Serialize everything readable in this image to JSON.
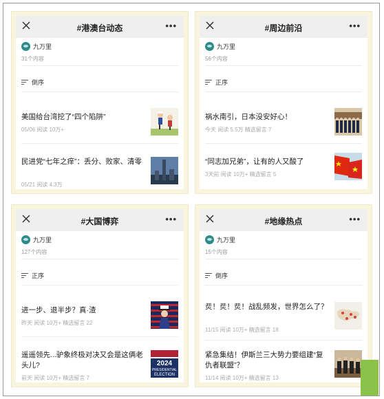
{
  "panels": [
    {
      "title": "#港澳台动态",
      "author": "九万里",
      "count": "31个内容",
      "sort": "倒序",
      "articles": [
        {
          "title": "美国给台湾挖了“四个陷阱”",
          "meta": "05/06  阅读 10万+",
          "thumb": "cartoon-figures"
        },
        {
          "title": "民进党“七年之痒”：丢分、败家、清零",
          "meta": "05/21  阅读 4.3万",
          "thumb": "taipei-101-skyline"
        }
      ]
    },
    {
      "title": "#周边前沿",
      "author": "九万里",
      "count": "56个内容",
      "sort": "正序",
      "articles": [
        {
          "title": "祸水南引，日本没安好心！",
          "meta": "今天  阅读 5.5万  精选留言 7",
          "thumb": "leaders-group-photo"
        },
        {
          "title": "“同志加兄弟”，让有的人又酸了",
          "meta": "3天前  阅读 10万+  精选留言 5",
          "thumb": "china-vietnam-flags"
        }
      ]
    },
    {
      "title": "#大国博弈",
      "author": "九万里",
      "count": "127个内容",
      "sort": "正序",
      "articles": [
        {
          "title": "进一步、退半步？真·渣",
          "meta": "昨天  阅读 10万+  精选留言 22",
          "thumb": "uncle-sam-flag"
        },
        {
          "title": "遥遥领先...驴象终极对决又会是这俩老头儿?",
          "meta": "前天  阅读 10万+  精选留言 7",
          "thumb": "2024 PRESIDENTIAL ELECTION"
        }
      ]
    },
    {
      "title": "#地缘热点",
      "author": "九万里",
      "count": "15个内容",
      "sort": "倒序",
      "articles": [
        {
          "title": "烎！烎！烎！战乱频发，世界怎么了？",
          "meta": "11/15  阅读 10万+  精选留言 18",
          "thumb": "world-map"
        },
        {
          "title": "紧急集结！伊斯兰三大势力要组建“复仇者联盟”？",
          "meta": "11/14  阅读 10万+  精选留言 13",
          "thumb": "meeting-photo"
        }
      ]
    }
  ],
  "thumb_text": {
    "election_year": "2024",
    "election_line1": "PRESIDENTIAL",
    "election_line2": "ELECTION"
  },
  "colors": {
    "panel_bg": "#f8f4dd",
    "topbar": "#efefef",
    "accent_green": "#8bc34a",
    "avatar": "#2f8a8a"
  }
}
